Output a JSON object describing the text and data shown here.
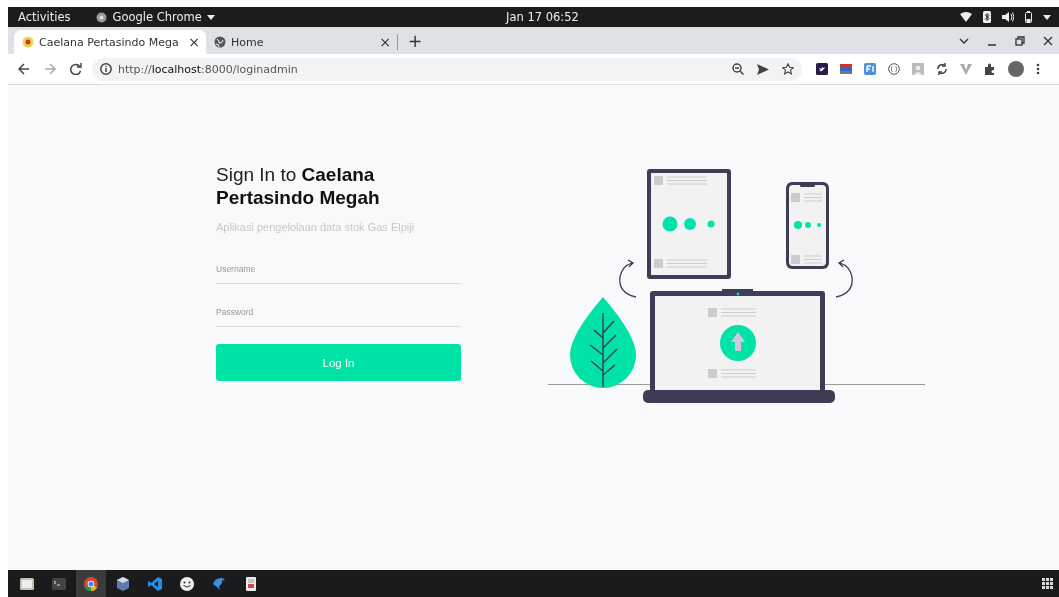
{
  "top_bar": {
    "activities": "Activities",
    "app_menu": "Google Chrome",
    "clock": "Jan 17  06:52"
  },
  "tabs": [
    {
      "title": "Caelana Pertasindo Mega",
      "close": "×",
      "selected": true
    },
    {
      "title": "Home",
      "close": "×",
      "selected": false
    }
  ],
  "new_tab": "+",
  "address_bar": {
    "url": "http://**localhost**:8000/loginadmin"
  },
  "login": {
    "title": "Sign In to **Caelana Pertasindo Megah**",
    "subtitle": "Aplikasi pengelolaan data stok Gas Elpiji",
    "fields": [
      {
        "placeholder": "Username"
      },
      {
        "placeholder": "Password"
      }
    ],
    "button": "Log In"
  },
  "dock": {
    "items": [
      {
        "kind": "files",
        "selected": false
      },
      {
        "kind": "terminal",
        "selected": false
      },
      {
        "kind": "browser",
        "selected": true
      },
      {
        "kind": "cube",
        "selected": false
      },
      {
        "kind": "editor",
        "selected": false
      },
      {
        "kind": "smiley",
        "selected": false
      },
      {
        "kind": "dolphin",
        "selected": false
      },
      {
        "kind": "document",
        "selected": false
      }
    ]
  }
}
